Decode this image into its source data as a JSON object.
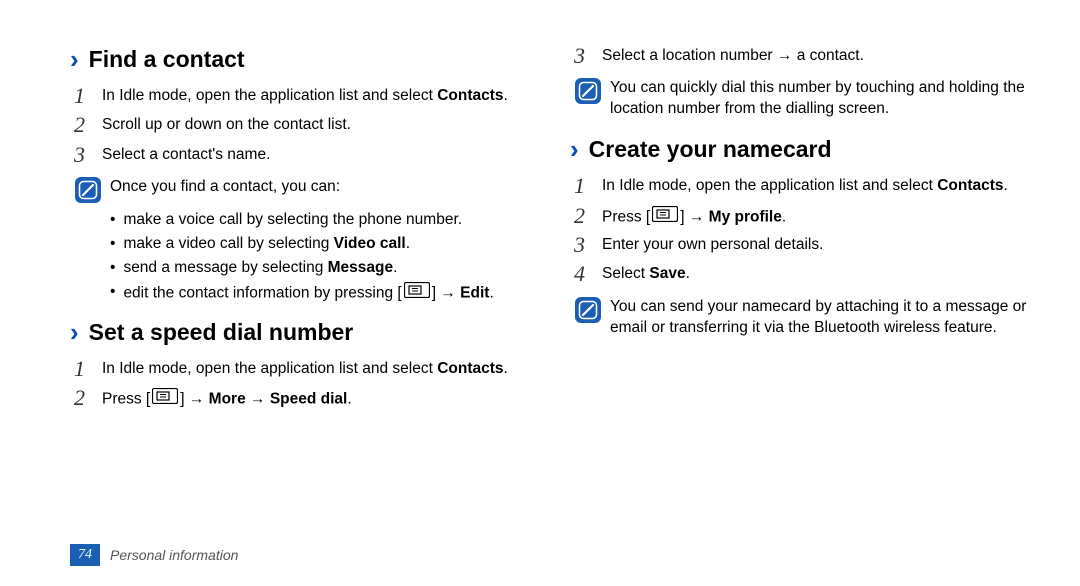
{
  "left": {
    "section1": {
      "title": "Find a contact",
      "step1_a": "In Idle mode, open the application list and select ",
      "step1_b": "Contacts",
      "step1_c": ".",
      "step2": "Scroll up or down on the contact list.",
      "step3": "Select a contact's name.",
      "note": "Once you find a contact, you can:",
      "bullet1": "make a voice call by selecting the phone number.",
      "bullet2_a": "make a video call by selecting ",
      "bullet2_b": "Video call",
      "bullet2_c": ".",
      "bullet3_a": "send a message by selecting ",
      "bullet3_b": "Message",
      "bullet3_c": ".",
      "bullet4_a": "edit the contact information by pressing [",
      "bullet4_b": "] → ",
      "bullet4_c": "Edit",
      "bullet4_d": "."
    },
    "section2": {
      "title": "Set a speed dial number",
      "step1_a": "In Idle mode, open the application list and select ",
      "step1_b": "Contacts",
      "step1_c": ".",
      "step2_a": "Press [",
      "step2_b": "] → ",
      "step2_c": "More",
      "step2_d": " → ",
      "step2_e": "Speed dial",
      "step2_f": "."
    }
  },
  "right": {
    "step3": "Select a location number → a contact.",
    "note1": "You can quickly dial this number by touching and holding the location number from the dialling screen.",
    "section3": {
      "title": "Create your namecard",
      "step1_a": "In Idle mode, open the application list and select ",
      "step1_b": "Contacts",
      "step1_c": ".",
      "step2_a": "Press [",
      "step2_b": "] → ",
      "step2_c": "My profile",
      "step2_d": ".",
      "step3": "Enter your own personal details.",
      "step4_a": "Select ",
      "step4_b": "Save",
      "step4_c": ".",
      "note": "You can send your namecard by attaching it to a message or email or transferring it via the Bluetooth wireless feature."
    }
  },
  "footer": {
    "page": "74",
    "text": "Personal information"
  },
  "nums": {
    "n1": "1",
    "n2": "2",
    "n3": "3",
    "n4": "4"
  }
}
